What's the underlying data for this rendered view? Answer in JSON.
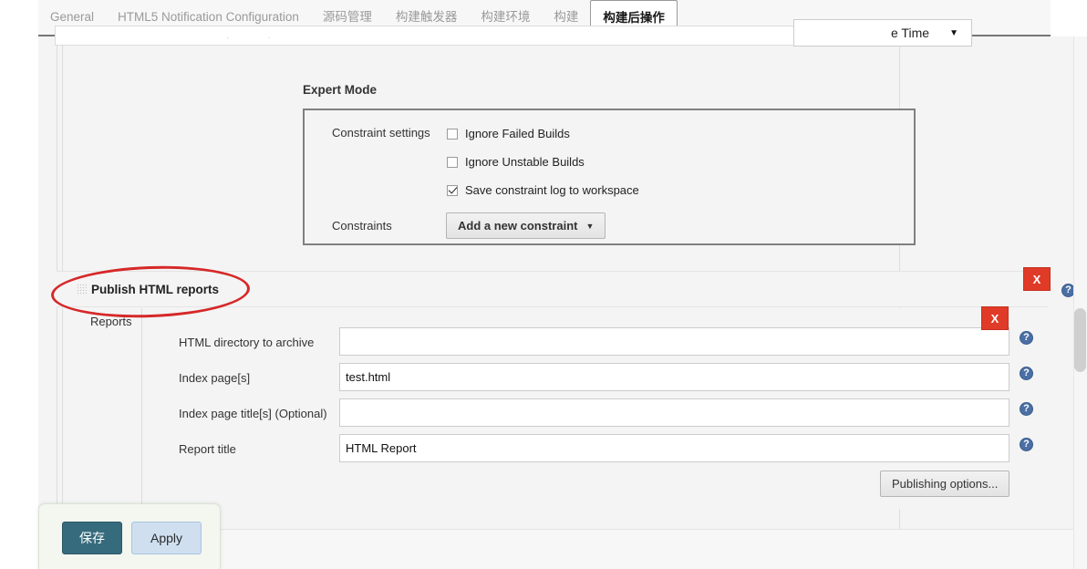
{
  "tabs": [
    {
      "label": "General",
      "active": false
    },
    {
      "label": "HTML5 Notification Configuration",
      "active": false
    },
    {
      "label": "源码管理",
      "active": false
    },
    {
      "label": "构建触发器",
      "active": false
    },
    {
      "label": "构建环境",
      "active": false
    },
    {
      "label": "构建",
      "active": false
    },
    {
      "label": "构建后操作",
      "active": true
    }
  ],
  "top_dropdown": {
    "value": "e Time",
    "caret": "▼"
  },
  "expert_mode": {
    "title": "Expert Mode",
    "constraint_settings_label": "Constraint settings",
    "checkboxes": [
      {
        "label": "Ignore Failed Builds",
        "checked": false
      },
      {
        "label": "Ignore Unstable Builds",
        "checked": false
      },
      {
        "label": "Save constraint log to workspace",
        "checked": true
      }
    ],
    "constraints_label": "Constraints",
    "add_constraint_button": "Add a new constraint",
    "add_constraint_caret": "▼"
  },
  "publish_section": {
    "title": "Publish HTML reports",
    "grip_icon": "drag-handle-icon",
    "delete_label": "X",
    "help_label": "?",
    "reports_label": "Reports",
    "fields": [
      {
        "label": "HTML directory to archive",
        "value": "",
        "placeholder": ""
      },
      {
        "label": "Index page[s]",
        "value": "test.html",
        "placeholder": ""
      },
      {
        "label": "Index page title[s] (Optional)",
        "value": "",
        "placeholder": ""
      },
      {
        "label": "Report title",
        "value": "HTML Report",
        "placeholder": ""
      }
    ],
    "publishing_options_button": "Publishing options..."
  },
  "footer": {
    "save_label": "保存",
    "apply_label": "Apply"
  },
  "colors": {
    "accent_red": "#d62828",
    "delete_red": "#e03b28",
    "save_teal": "#366b7d",
    "apply_blue": "#cfdff0",
    "help_blue": "#4a6fa5"
  }
}
